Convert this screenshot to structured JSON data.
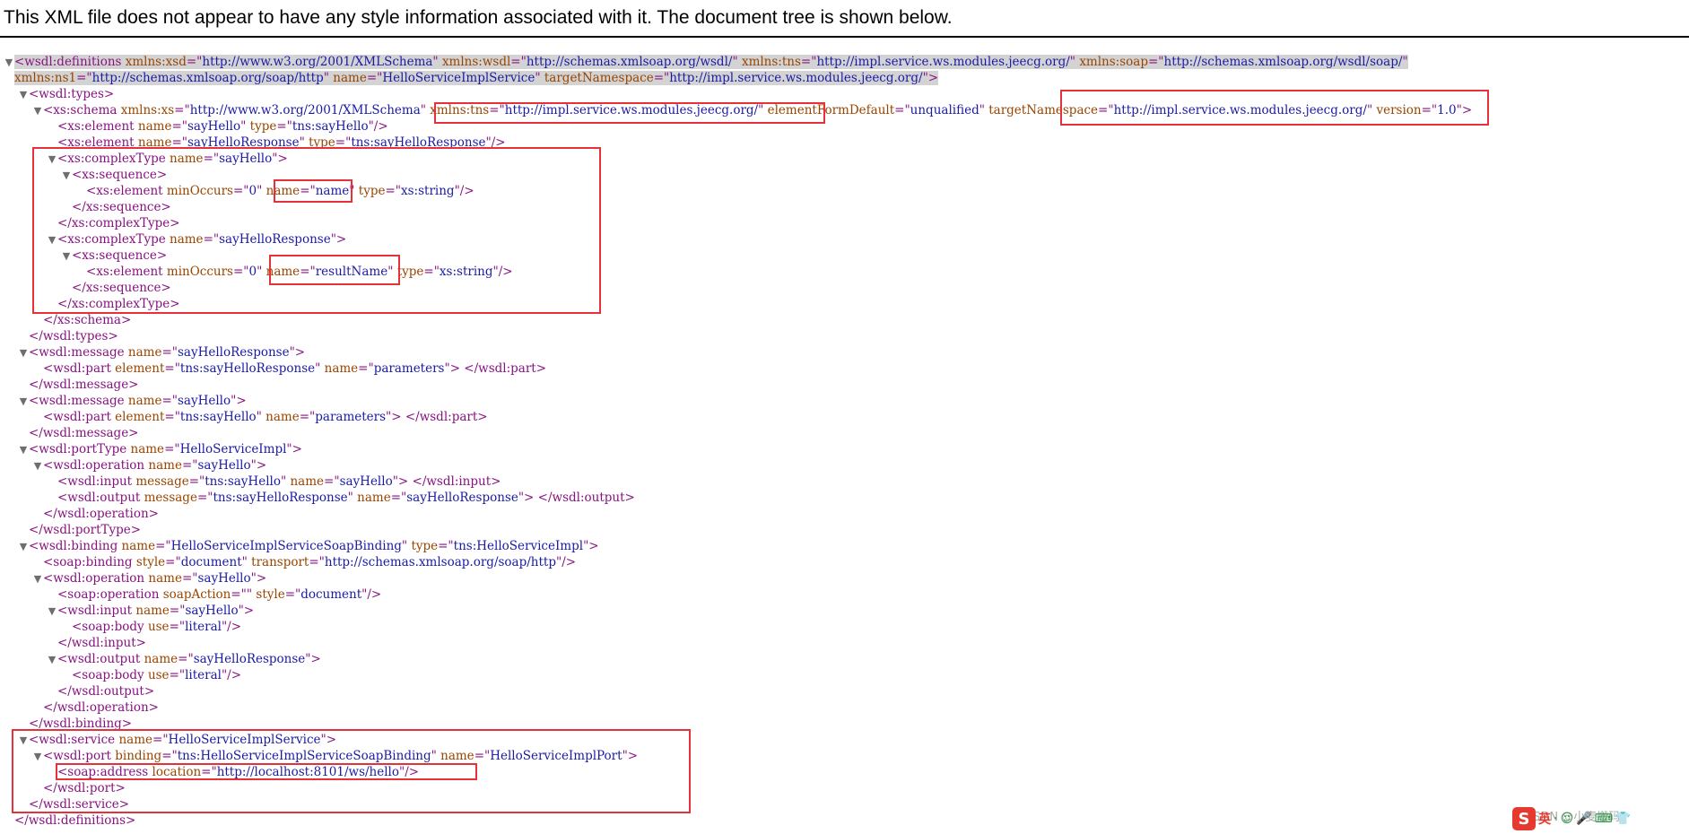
{
  "banner": {
    "message": "This XML file does not appear to have any style information associated with it. The document tree is shown below."
  },
  "xml_lines": [
    {
      "level": 0,
      "toggle": true,
      "highlight": true,
      "parts": [
        [
          "t",
          "<wsdl:definitions "
        ],
        [
          "a",
          "xmlns:xsd"
        ],
        [
          "t",
          "=\""
        ],
        [
          "v",
          "http://www.w3.org/2001/XMLSchema"
        ],
        [
          "t",
          "\" "
        ],
        [
          "a",
          "xmlns:wsdl"
        ],
        [
          "t",
          "=\""
        ],
        [
          "v",
          "http://schemas.xmlsoap.org/wsdl/"
        ],
        [
          "t",
          "\" "
        ],
        [
          "a",
          "xmlns:tns"
        ],
        [
          "t",
          "=\""
        ],
        [
          "v",
          "http://impl.service.ws.modules.jeecg.org/"
        ],
        [
          "t",
          "\" "
        ],
        [
          "a",
          "xmlns:soap"
        ],
        [
          "t",
          "=\""
        ],
        [
          "v",
          "http://schemas.xmlsoap.org/wsdl/soap/"
        ],
        [
          "t",
          "\""
        ]
      ]
    },
    {
      "level": 0,
      "toggle": false,
      "cont": true,
      "highlight": true,
      "parts": [
        [
          "a",
          "xmlns:ns1"
        ],
        [
          "t",
          "=\""
        ],
        [
          "v",
          "http://schemas.xmlsoap.org/soap/http"
        ],
        [
          "t",
          "\" "
        ],
        [
          "a",
          "name"
        ],
        [
          "t",
          "=\""
        ],
        [
          "v",
          "HelloServiceImplService"
        ],
        [
          "t",
          "\" "
        ],
        [
          "a",
          "targetNamespace"
        ],
        [
          "t",
          "=\""
        ],
        [
          "v",
          "http://impl.service.ws.modules.jeecg.org/"
        ],
        [
          "t",
          "\">"
        ]
      ]
    },
    {
      "level": 1,
      "toggle": true,
      "parts": [
        [
          "t",
          "<wsdl:types>"
        ]
      ]
    },
    {
      "level": 2,
      "toggle": true,
      "parts": [
        [
          "t",
          "<xs:schema "
        ],
        [
          "a",
          "xmlns:xs"
        ],
        [
          "t",
          "=\""
        ],
        [
          "v",
          "http://www.w3.org/2001/XMLSchema"
        ],
        [
          "t",
          "\" "
        ],
        [
          "a",
          "xmlns:tns"
        ],
        [
          "t",
          "=\""
        ],
        [
          "v",
          "http://impl.service.ws.modules.jeecg.org/"
        ],
        [
          "t",
          "\" "
        ],
        [
          "a",
          "elementFormDefault"
        ],
        [
          "t",
          "=\""
        ],
        [
          "v",
          "unqualified"
        ],
        [
          "t",
          "\" "
        ],
        [
          "a",
          "targetNamespace"
        ],
        [
          "t",
          "=\""
        ],
        [
          "v",
          "http://impl.service.ws.modules.jeecg.org/"
        ],
        [
          "t",
          "\" "
        ],
        [
          "a",
          "version"
        ],
        [
          "t",
          "=\""
        ],
        [
          "v",
          "1.0"
        ],
        [
          "t",
          "\">"
        ]
      ]
    },
    {
      "level": 3,
      "toggle": false,
      "parts": [
        [
          "t",
          "<xs:element "
        ],
        [
          "a",
          "name"
        ],
        [
          "t",
          "=\""
        ],
        [
          "v",
          "sayHello"
        ],
        [
          "t",
          "\" "
        ],
        [
          "a",
          "type"
        ],
        [
          "t",
          "=\""
        ],
        [
          "v",
          "tns:sayHello"
        ],
        [
          "t",
          "\"/>"
        ]
      ]
    },
    {
      "level": 3,
      "toggle": false,
      "parts": [
        [
          "t",
          "<xs:element "
        ],
        [
          "a",
          "name"
        ],
        [
          "t",
          "=\""
        ],
        [
          "v",
          "sayHelloResponse"
        ],
        [
          "t",
          "\" "
        ],
        [
          "a",
          "type"
        ],
        [
          "t",
          "=\""
        ],
        [
          "v",
          "tns:sayHelloResponse"
        ],
        [
          "t",
          "\"/>"
        ]
      ]
    },
    {
      "level": 3,
      "toggle": true,
      "parts": [
        [
          "t",
          "<xs:complexType "
        ],
        [
          "a",
          "name"
        ],
        [
          "t",
          "=\""
        ],
        [
          "v",
          "sayHello"
        ],
        [
          "t",
          "\">"
        ]
      ]
    },
    {
      "level": 4,
      "toggle": true,
      "parts": [
        [
          "t",
          "<xs:sequence>"
        ]
      ]
    },
    {
      "level": 5,
      "toggle": false,
      "parts": [
        [
          "t",
          "<xs:element "
        ],
        [
          "a",
          "minOccurs"
        ],
        [
          "t",
          "=\""
        ],
        [
          "v",
          "0"
        ],
        [
          "t",
          "\" "
        ],
        [
          "a",
          "name"
        ],
        [
          "t",
          "=\""
        ],
        [
          "v",
          "name"
        ],
        [
          "t",
          "\" "
        ],
        [
          "a",
          "type"
        ],
        [
          "t",
          "=\""
        ],
        [
          "v",
          "xs:string"
        ],
        [
          "t",
          "\"/>"
        ]
      ]
    },
    {
      "level": 4,
      "toggle": false,
      "parts": [
        [
          "t",
          "</xs:sequence>"
        ]
      ]
    },
    {
      "level": 3,
      "toggle": false,
      "parts": [
        [
          "t",
          "</xs:complexType>"
        ]
      ]
    },
    {
      "level": 3,
      "toggle": true,
      "parts": [
        [
          "t",
          "<xs:complexType "
        ],
        [
          "a",
          "name"
        ],
        [
          "t",
          "=\""
        ],
        [
          "v",
          "sayHelloResponse"
        ],
        [
          "t",
          "\">"
        ]
      ]
    },
    {
      "level": 4,
      "toggle": true,
      "parts": [
        [
          "t",
          "<xs:sequence>"
        ]
      ]
    },
    {
      "level": 5,
      "toggle": false,
      "parts": [
        [
          "t",
          "<xs:element "
        ],
        [
          "a",
          "minOccurs"
        ],
        [
          "t",
          "=\""
        ],
        [
          "v",
          "0"
        ],
        [
          "t",
          "\" "
        ],
        [
          "a",
          "name"
        ],
        [
          "t",
          "=\""
        ],
        [
          "v",
          "resultName"
        ],
        [
          "t",
          "\" "
        ],
        [
          "a",
          "type"
        ],
        [
          "t",
          "=\""
        ],
        [
          "v",
          "xs:string"
        ],
        [
          "t",
          "\"/>"
        ]
      ]
    },
    {
      "level": 4,
      "toggle": false,
      "parts": [
        [
          "t",
          "</xs:sequence>"
        ]
      ]
    },
    {
      "level": 3,
      "toggle": false,
      "parts": [
        [
          "t",
          "</xs:complexType>"
        ]
      ]
    },
    {
      "level": 2,
      "toggle": false,
      "parts": [
        [
          "t",
          "</xs:schema>"
        ]
      ]
    },
    {
      "level": 1,
      "toggle": false,
      "parts": [
        [
          "t",
          "</wsdl:types>"
        ]
      ]
    },
    {
      "level": 1,
      "toggle": true,
      "parts": [
        [
          "t",
          "<wsdl:message "
        ],
        [
          "a",
          "name"
        ],
        [
          "t",
          "=\""
        ],
        [
          "v",
          "sayHelloResponse"
        ],
        [
          "t",
          "\">"
        ]
      ]
    },
    {
      "level": 2,
      "toggle": false,
      "parts": [
        [
          "t",
          "<wsdl:part "
        ],
        [
          "a",
          "element"
        ],
        [
          "t",
          "=\""
        ],
        [
          "v",
          "tns:sayHelloResponse"
        ],
        [
          "t",
          "\" "
        ],
        [
          "a",
          "name"
        ],
        [
          "t",
          "=\""
        ],
        [
          "v",
          "parameters"
        ],
        [
          "t",
          "\"> </wsdl:part>"
        ]
      ]
    },
    {
      "level": 1,
      "toggle": false,
      "parts": [
        [
          "t",
          "</wsdl:message>"
        ]
      ]
    },
    {
      "level": 1,
      "toggle": true,
      "parts": [
        [
          "t",
          "<wsdl:message "
        ],
        [
          "a",
          "name"
        ],
        [
          "t",
          "=\""
        ],
        [
          "v",
          "sayHello"
        ],
        [
          "t",
          "\">"
        ]
      ]
    },
    {
      "level": 2,
      "toggle": false,
      "parts": [
        [
          "t",
          "<wsdl:part "
        ],
        [
          "a",
          "element"
        ],
        [
          "t",
          "=\""
        ],
        [
          "v",
          "tns:sayHello"
        ],
        [
          "t",
          "\" "
        ],
        [
          "a",
          "name"
        ],
        [
          "t",
          "=\""
        ],
        [
          "v",
          "parameters"
        ],
        [
          "t",
          "\"> </wsdl:part>"
        ]
      ]
    },
    {
      "level": 1,
      "toggle": false,
      "parts": [
        [
          "t",
          "</wsdl:message>"
        ]
      ]
    },
    {
      "level": 1,
      "toggle": true,
      "parts": [
        [
          "t",
          "<wsdl:portType "
        ],
        [
          "a",
          "name"
        ],
        [
          "t",
          "=\""
        ],
        [
          "v",
          "HelloServiceImpl"
        ],
        [
          "t",
          "\">"
        ]
      ]
    },
    {
      "level": 2,
      "toggle": true,
      "parts": [
        [
          "t",
          "<wsdl:operation "
        ],
        [
          "a",
          "name"
        ],
        [
          "t",
          "=\""
        ],
        [
          "v",
          "sayHello"
        ],
        [
          "t",
          "\">"
        ]
      ]
    },
    {
      "level": 3,
      "toggle": false,
      "parts": [
        [
          "t",
          "<wsdl:input "
        ],
        [
          "a",
          "message"
        ],
        [
          "t",
          "=\""
        ],
        [
          "v",
          "tns:sayHello"
        ],
        [
          "t",
          "\" "
        ],
        [
          "a",
          "name"
        ],
        [
          "t",
          "=\""
        ],
        [
          "v",
          "sayHello"
        ],
        [
          "t",
          "\"> </wsdl:input>"
        ]
      ]
    },
    {
      "level": 3,
      "toggle": false,
      "parts": [
        [
          "t",
          "<wsdl:output "
        ],
        [
          "a",
          "message"
        ],
        [
          "t",
          "=\""
        ],
        [
          "v",
          "tns:sayHelloResponse"
        ],
        [
          "t",
          "\" "
        ],
        [
          "a",
          "name"
        ],
        [
          "t",
          "=\""
        ],
        [
          "v",
          "sayHelloResponse"
        ],
        [
          "t",
          "\"> </wsdl:output>"
        ]
      ]
    },
    {
      "level": 2,
      "toggle": false,
      "parts": [
        [
          "t",
          "</wsdl:operation>"
        ]
      ]
    },
    {
      "level": 1,
      "toggle": false,
      "parts": [
        [
          "t",
          "</wsdl:portType>"
        ]
      ]
    },
    {
      "level": 1,
      "toggle": true,
      "parts": [
        [
          "t",
          "<wsdl:binding "
        ],
        [
          "a",
          "name"
        ],
        [
          "t",
          "=\""
        ],
        [
          "v",
          "HelloServiceImplServiceSoapBinding"
        ],
        [
          "t",
          "\" "
        ],
        [
          "a",
          "type"
        ],
        [
          "t",
          "=\""
        ],
        [
          "v",
          "tns:HelloServiceImpl"
        ],
        [
          "t",
          "\">"
        ]
      ]
    },
    {
      "level": 2,
      "toggle": false,
      "parts": [
        [
          "t",
          "<soap:binding "
        ],
        [
          "a",
          "style"
        ],
        [
          "t",
          "=\""
        ],
        [
          "v",
          "document"
        ],
        [
          "t",
          "\" "
        ],
        [
          "a",
          "transport"
        ],
        [
          "t",
          "=\""
        ],
        [
          "v",
          "http://schemas.xmlsoap.org/soap/http"
        ],
        [
          "t",
          "\"/>"
        ]
      ]
    },
    {
      "level": 2,
      "toggle": true,
      "parts": [
        [
          "t",
          "<wsdl:operation "
        ],
        [
          "a",
          "name"
        ],
        [
          "t",
          "=\""
        ],
        [
          "v",
          "sayHello"
        ],
        [
          "t",
          "\">"
        ]
      ]
    },
    {
      "level": 3,
      "toggle": false,
      "parts": [
        [
          "t",
          "<soap:operation "
        ],
        [
          "a",
          "soapAction"
        ],
        [
          "t",
          "=\"\" "
        ],
        [
          "a",
          "style"
        ],
        [
          "t",
          "=\""
        ],
        [
          "v",
          "document"
        ],
        [
          "t",
          "\"/>"
        ]
      ]
    },
    {
      "level": 3,
      "toggle": true,
      "parts": [
        [
          "t",
          "<wsdl:input "
        ],
        [
          "a",
          "name"
        ],
        [
          "t",
          "=\""
        ],
        [
          "v",
          "sayHello"
        ],
        [
          "t",
          "\">"
        ]
      ]
    },
    {
      "level": 4,
      "toggle": false,
      "parts": [
        [
          "t",
          "<soap:body "
        ],
        [
          "a",
          "use"
        ],
        [
          "t",
          "=\""
        ],
        [
          "v",
          "literal"
        ],
        [
          "t",
          "\"/>"
        ]
      ]
    },
    {
      "level": 3,
      "toggle": false,
      "parts": [
        [
          "t",
          "</wsdl:input>"
        ]
      ]
    },
    {
      "level": 3,
      "toggle": true,
      "parts": [
        [
          "t",
          "<wsdl:output "
        ],
        [
          "a",
          "name"
        ],
        [
          "t",
          "=\""
        ],
        [
          "v",
          "sayHelloResponse"
        ],
        [
          "t",
          "\">"
        ]
      ]
    },
    {
      "level": 4,
      "toggle": false,
      "parts": [
        [
          "t",
          "<soap:body "
        ],
        [
          "a",
          "use"
        ],
        [
          "t",
          "=\""
        ],
        [
          "v",
          "literal"
        ],
        [
          "t",
          "\"/>"
        ]
      ]
    },
    {
      "level": 3,
      "toggle": false,
      "parts": [
        [
          "t",
          "</wsdl:output>"
        ]
      ]
    },
    {
      "level": 2,
      "toggle": false,
      "parts": [
        [
          "t",
          "</wsdl:operation>"
        ]
      ]
    },
    {
      "level": 1,
      "toggle": false,
      "parts": [
        [
          "t",
          "</wsdl:binding>"
        ]
      ]
    },
    {
      "level": 1,
      "toggle": true,
      "parts": [
        [
          "t",
          "<wsdl:service "
        ],
        [
          "a",
          "name"
        ],
        [
          "t",
          "=\""
        ],
        [
          "v",
          "HelloServiceImplService"
        ],
        [
          "t",
          "\">"
        ]
      ]
    },
    {
      "level": 2,
      "toggle": true,
      "parts": [
        [
          "t",
          "<wsdl:port "
        ],
        [
          "a",
          "binding"
        ],
        [
          "t",
          "=\""
        ],
        [
          "v",
          "tns:HelloServiceImplServiceSoapBinding"
        ],
        [
          "t",
          "\" "
        ],
        [
          "a",
          "name"
        ],
        [
          "t",
          "=\""
        ],
        [
          "v",
          "HelloServiceImplPort"
        ],
        [
          "t",
          "\">"
        ]
      ]
    },
    {
      "level": 3,
      "toggle": false,
      "parts": [
        [
          "t",
          "<soap:address "
        ],
        [
          "a",
          "location"
        ],
        [
          "t",
          "=\""
        ],
        [
          "v",
          "http://localhost:8101/ws/hello"
        ],
        [
          "t",
          "\"/>"
        ]
      ]
    },
    {
      "level": 2,
      "toggle": false,
      "parts": [
        [
          "t",
          "</wsdl:port>"
        ]
      ]
    },
    {
      "level": 1,
      "toggle": false,
      "parts": [
        [
          "t",
          "</wsdl:service>"
        ]
      ]
    },
    {
      "level": 0,
      "toggle": false,
      "parts": [
        [
          "t",
          "</wsdl:definitions>"
        ]
      ]
    }
  ],
  "watermark": {
    "text": "CSDN @小麦搬码"
  },
  "ime": {
    "logo": "S",
    "lang": "英",
    "icons": [
      "·",
      "☺",
      "🎤",
      "⌨",
      "👕"
    ]
  },
  "colors": {
    "tag": "#881280",
    "attr_name": "#994500",
    "attr_value": "#1a1aa6",
    "annotation_box": "#e5323a"
  }
}
